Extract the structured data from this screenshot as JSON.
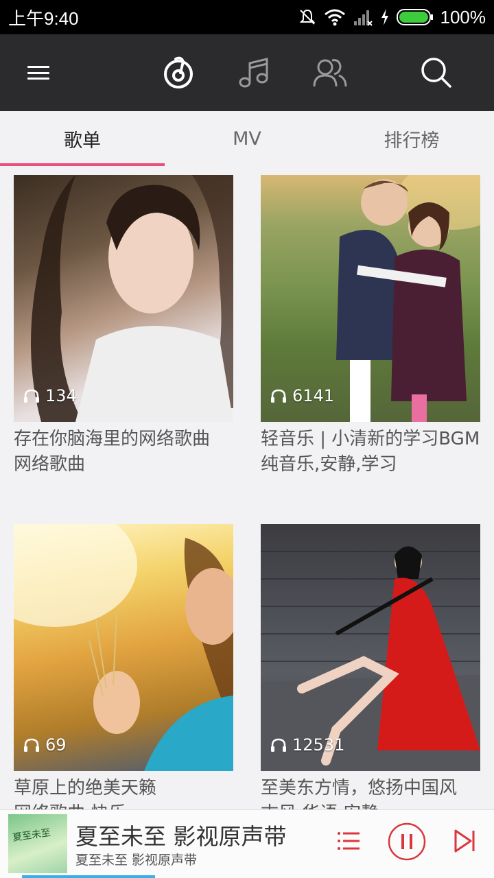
{
  "status_bar": {
    "time": "上午9:40",
    "battery": "100%",
    "icons": [
      "mute-bell-icon",
      "wifi-icon",
      "signal-icon",
      "charging-icon",
      "battery-icon"
    ]
  },
  "app_bar": {
    "icons": [
      "menu-icon",
      "netease-music-logo-icon",
      "music-note-icon",
      "friends-icon",
      "search-icon"
    ]
  },
  "tabs": [
    {
      "label": "歌单",
      "active": true
    },
    {
      "label": "MV",
      "active": false
    },
    {
      "label": "排行榜",
      "active": false
    }
  ],
  "playlists": [
    {
      "plays": "134",
      "title": "存在你脑海里的网络歌曲",
      "tags": "网络歌曲"
    },
    {
      "plays": "6141",
      "title": "轻音乐 | 小清新的学习BGM",
      "tags": "纯音乐,安静,学习"
    },
    {
      "plays": "69",
      "title": "草原上的绝美天籁",
      "tags": "网络歌曲,快乐"
    },
    {
      "plays": "12531",
      "title": "至美东方情，悠扬中国风",
      "tags": "古风,华语,安静"
    }
  ],
  "player": {
    "cover_text": "夏至未至",
    "song": "夏至未至 影视原声带",
    "artist": "夏至未至 影视原声带",
    "progress": 0.27
  },
  "colors": {
    "accent": "#e94f7d",
    "player_red": "#d9363e",
    "app_bar": "#2b2b2e"
  }
}
